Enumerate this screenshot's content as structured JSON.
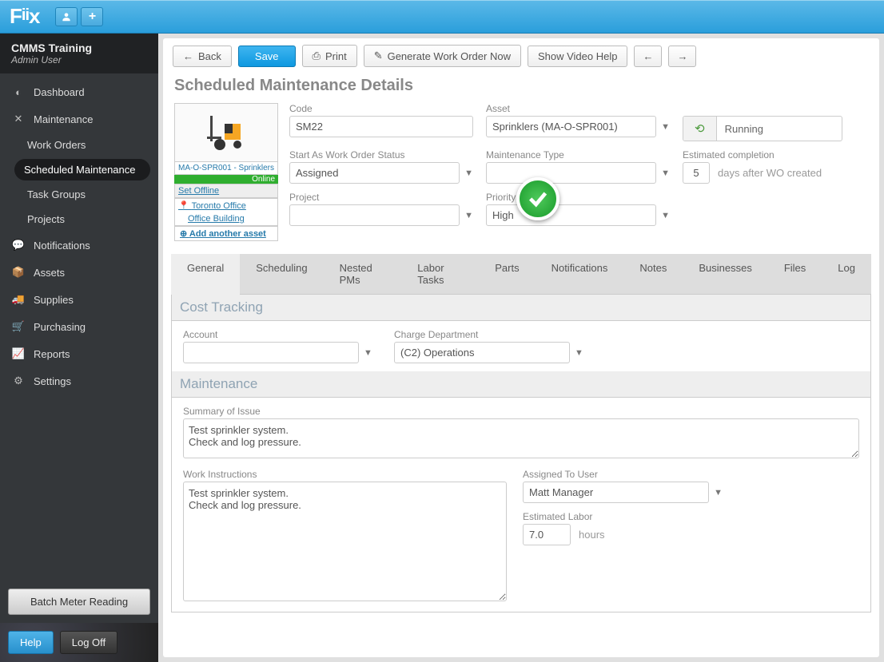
{
  "app": {
    "logo": "Fiix",
    "tenant": "CMMS Training",
    "user": "Admin User"
  },
  "toolbar": {
    "back": "Back",
    "save": "Save",
    "print": "Print",
    "generate": "Generate Work Order Now",
    "video": "Show Video Help"
  },
  "page": {
    "title": "Scheduled Maintenance Details"
  },
  "sidebar": {
    "items": [
      {
        "label": "Dashboard"
      },
      {
        "label": "Maintenance"
      },
      {
        "label": "Notifications"
      },
      {
        "label": "Assets"
      },
      {
        "label": "Supplies"
      },
      {
        "label": "Purchasing"
      },
      {
        "label": "Reports"
      },
      {
        "label": "Settings"
      }
    ],
    "maintenance_subs": [
      "Work Orders",
      "Scheduled Maintenance",
      "Task Groups",
      "Projects"
    ],
    "batch_button": "Batch Meter Reading",
    "help": "Help",
    "logoff": "Log Off"
  },
  "asset_card": {
    "caption": "MA-O-SPR001 - Sprinklers",
    "online": "Online",
    "set_offline": "Set Offline",
    "tree": [
      "Toronto Office",
      "Office Building"
    ],
    "add_another": "Add another asset"
  },
  "fields": {
    "code": {
      "label": "Code",
      "value": "SM22"
    },
    "asset": {
      "label": "Asset",
      "value": "Sprinklers (MA-O-SPR001)"
    },
    "status": {
      "label": "Running"
    },
    "start_status": {
      "label": "Start As Work Order Status",
      "value": "Assigned"
    },
    "maint_type": {
      "label": "Maintenance Type",
      "value": ""
    },
    "est_completion": {
      "label": "Estimated completion",
      "value": "5",
      "suffix": "days after WO created"
    },
    "project": {
      "label": "Project",
      "value": ""
    },
    "priority": {
      "label": "Priority",
      "value": "High"
    }
  },
  "tabs": [
    "General",
    "Scheduling",
    "Nested PMs",
    "Labor Tasks",
    "Parts",
    "Notifications",
    "Notes",
    "Businesses",
    "Files",
    "Log"
  ],
  "cost_tracking": {
    "title": "Cost Tracking",
    "account": {
      "label": "Account",
      "value": ""
    },
    "charge_dept": {
      "label": "Charge Department",
      "value": "(C2) Operations"
    }
  },
  "maintenance": {
    "title": "Maintenance",
    "summary": {
      "label": "Summary of Issue",
      "value": "Test sprinkler system.\nCheck and log pressure."
    },
    "instructions": {
      "label": "Work Instructions",
      "value": "Test sprinkler system.\nCheck and log pressure."
    },
    "assigned": {
      "label": "Assigned To User",
      "value": "Matt Manager"
    },
    "est_labor": {
      "label": "Estimated Labor",
      "value": "7.0",
      "unit": "hours"
    }
  }
}
